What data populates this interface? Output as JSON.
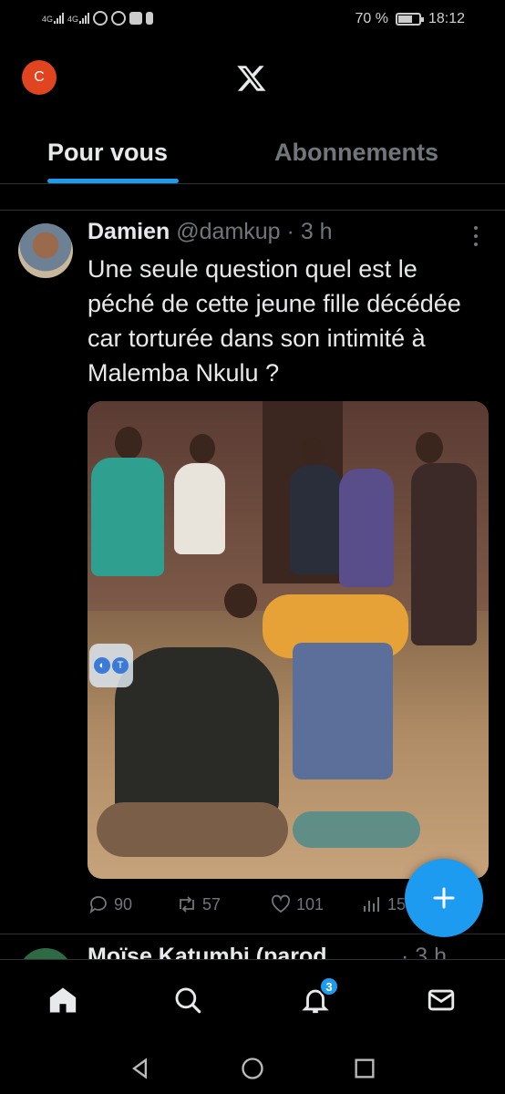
{
  "status_bar": {
    "signal_1": "4G",
    "signal_2": "4G",
    "battery_percent_text": "70 %",
    "battery_level": 0.7,
    "time": "18:12"
  },
  "header": {
    "account_initial": "C",
    "logo_icon": "x-logo-icon"
  },
  "tabs": [
    {
      "label": "Pour vous",
      "active": true
    },
    {
      "label": "Abonnements",
      "active": false
    }
  ],
  "tweet": {
    "name": "Damien",
    "handle": "@damkup",
    "separator": "·",
    "time": "3 h",
    "text": "Une seule question quel est le péché de cette jeune fille décédée car torturée dans son intimité à Malemba Nkulu ?",
    "media_badge": "T",
    "stats": {
      "replies": "90",
      "reposts": "57",
      "likes": "101",
      "views": "15"
    }
  },
  "next_tweet": {
    "name": "Moïse Katumbi (parod",
    "time": "· 3 h"
  },
  "bottom_nav": {
    "items": [
      "home-icon",
      "search-icon",
      "bell-icon",
      "mail-icon"
    ],
    "notification_count": "3"
  },
  "colors": {
    "accent": "#1d9bf0",
    "background": "#000000",
    "muted_text": "#71767b",
    "avatar_me": "#e0451f"
  }
}
